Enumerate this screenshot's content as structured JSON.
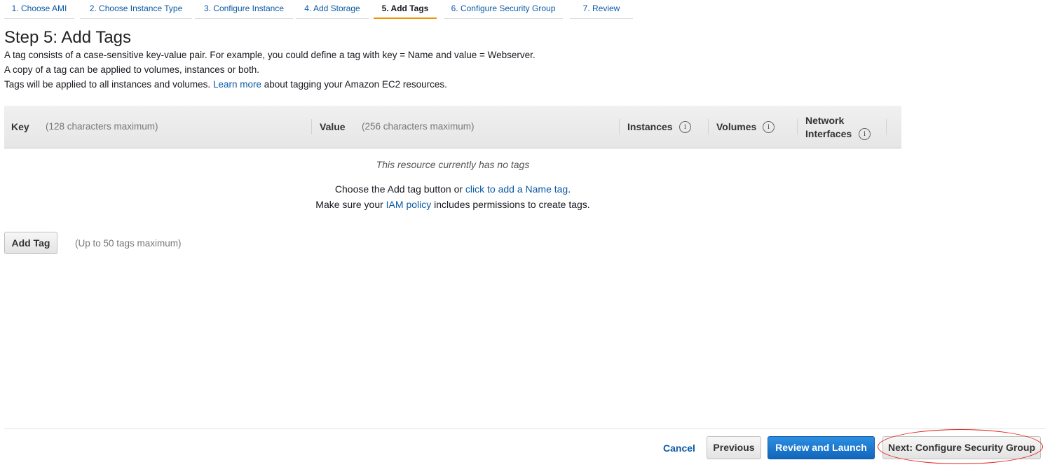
{
  "wizard": {
    "tabs": [
      {
        "label": "1. Choose AMI"
      },
      {
        "label": "2. Choose Instance Type"
      },
      {
        "label": "3. Configure Instance"
      },
      {
        "label": "4. Add Storage"
      },
      {
        "label": "5. Add Tags",
        "active": true
      },
      {
        "label": "6. Configure Security Group"
      },
      {
        "label": "7. Review"
      }
    ]
  },
  "page": {
    "title": "Step 5: Add Tags",
    "desc_line1": "A tag consists of a case-sensitive key-value pair. For example, you could define a tag with key = Name and value = Webserver.",
    "desc_line2": "A copy of a tag can be applied to volumes, instances or both.",
    "desc_line3_pre": "Tags will be applied to all instances and volumes.",
    "desc_line3_link": "Learn more",
    "desc_line3_post": "about tagging your Amazon EC2 resources."
  },
  "table": {
    "key_header": "Key",
    "key_hint": "(128 characters maximum)",
    "value_header": "Value",
    "value_hint": "(256 characters maximum)",
    "instances_header": "Instances",
    "volumes_header": "Volumes",
    "network_header_1": "Network",
    "network_header_2": "Interfaces",
    "info_glyph": "i"
  },
  "empty_state": {
    "message": "This resource currently has no tags",
    "line1_pre": "Choose the Add tag button or",
    "line1_link": "click to add a Name tag",
    "line1_post": ".",
    "line2_pre": "Make sure your",
    "line2_link": "IAM policy",
    "line2_post": "includes permissions to create tags."
  },
  "actions": {
    "add_tag": "Add Tag",
    "add_tag_hint": "(Up to 50 tags maximum)",
    "cancel": "Cancel",
    "previous": "Previous",
    "review_launch": "Review and Launch",
    "next": "Next: Configure Security Group"
  },
  "colors": {
    "link": "#0a5aa5",
    "active_tab_underline": "#ec9400",
    "primary_button": "#1166bb",
    "annotation_circle": "#e0201a"
  },
  "icons": {
    "info": "info-circle-icon"
  }
}
